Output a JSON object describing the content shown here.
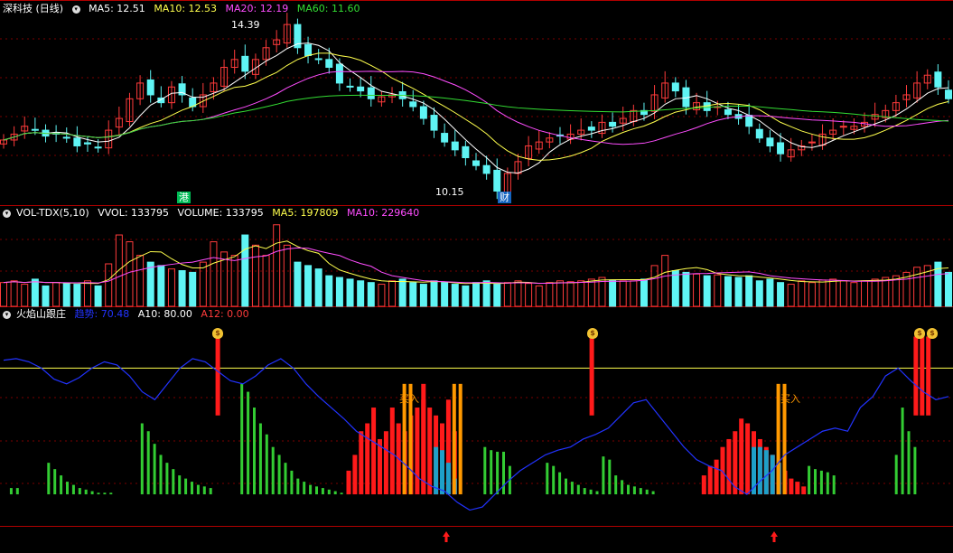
{
  "colors": {
    "up": "#ff3b3b",
    "down": "#5ff4f4",
    "ma5": "#ffffff",
    "ma10": "#ffff4d",
    "ma20": "#ff4dff",
    "ma60": "#33dd33",
    "axis": "#b00000",
    "grid": "#7a0000",
    "trend": "#2233ff",
    "ref": "#ffff4d",
    "green": "#33cc33",
    "red": "#ff1a1a",
    "orange": "#ff9900",
    "teal": "#1ea0c8"
  },
  "price_panel": {
    "title": "深科技 (日线)",
    "icon": "chevron-down-icon",
    "indicators": [
      {
        "label": "MA5: 12.51",
        "color": "#ffffff"
      },
      {
        "label": "MA10: 12.53",
        "color": "#ffff4d"
      },
      {
        "label": "MA20: 12.19",
        "color": "#ff4dff"
      },
      {
        "label": "MA60: 11.60",
        "color": "#33dd33"
      }
    ],
    "high_label": "14.39",
    "low_label": "10.15",
    "badge1": "港",
    "badge2": "财"
  },
  "volume_panel": {
    "title": "VOL-TDX(5,10)",
    "indicators": [
      {
        "label": "VVOL: 133795",
        "color": "#ffffff"
      },
      {
        "label": "VOLUME: 133795",
        "color": "#ffffff"
      },
      {
        "label": "MA5: 197809",
        "color": "#ffff4d"
      },
      {
        "label": "MA10: 229640",
        "color": "#ff4dff"
      }
    ]
  },
  "flame_panel": {
    "title": "火焰山跟庄",
    "indicators": [
      {
        "label": "趋势: 70.48",
        "color": "#2233ff"
      },
      {
        "label": "A10: 80.00",
        "color": "#ffffff"
      },
      {
        "label": "A12: 0.00",
        "color": "#ff3b3b"
      }
    ],
    "buy_label": "买入",
    "bag_glyph": "$"
  },
  "chart_data": [
    {
      "type": "candlestick",
      "title": "深科技 (日线)",
      "y_range_approx": [
        10.0,
        14.6
      ],
      "annotated_high": 14.39,
      "annotated_low": 10.15,
      "moving_averages": {
        "MA5": 12.51,
        "MA10": 12.53,
        "MA20": 12.19,
        "MA60": 11.6
      },
      "close_series": [
        11.45,
        11.6,
        11.8,
        11.7,
        11.55,
        11.6,
        11.5,
        11.3,
        11.35,
        11.25,
        11.7,
        12.0,
        12.5,
        12.9,
        12.6,
        12.4,
        12.8,
        12.6,
        12.3,
        12.6,
        12.9,
        13.3,
        13.5,
        13.2,
        13.5,
        13.8,
        14.0,
        14.39,
        13.8,
        13.6,
        13.5,
        13.3,
        12.9,
        12.8,
        12.7,
        12.5,
        12.55,
        12.6,
        12.5,
        12.3,
        12.0,
        11.7,
        11.4,
        11.2,
        11.0,
        10.8,
        10.6,
        10.15,
        10.6,
        10.9,
        11.3,
        11.4,
        11.5,
        11.55,
        11.6,
        11.7,
        11.7,
        11.9,
        11.8,
        12.0,
        12.2,
        12.1,
        12.6,
        12.9,
        12.7,
        12.3,
        12.4,
        12.2,
        12.3,
        12.1,
        12.0,
        11.8,
        11.5,
        11.3,
        11.1,
        11.2,
        11.3,
        11.4,
        11.6,
        11.7,
        11.8,
        11.8,
        11.9,
        12.1,
        12.2,
        12.4,
        12.6,
        12.9,
        13.1,
        12.8,
        12.5
      ]
    },
    {
      "type": "bar",
      "title": "VOL-TDX(5,10)",
      "latest": {
        "VOLUME": 133795,
        "MA5": 197809,
        "MA10": 229640
      },
      "volume_series": [
        140,
        150,
        130,
        160,
        120,
        140,
        135,
        130,
        150,
        120,
        250,
        420,
        380,
        300,
        260,
        240,
        220,
        210,
        200,
        260,
        380,
        320,
        300,
        420,
        360,
        300,
        480,
        360,
        260,
        240,
        220,
        180,
        170,
        160,
        150,
        140,
        130,
        150,
        160,
        140,
        130,
        150,
        140,
        130,
        120,
        140,
        150,
        130,
        140,
        150,
        135,
        120,
        140,
        150,
        145,
        150,
        160,
        170,
        155,
        150,
        150,
        160,
        240,
        300,
        210,
        200,
        190,
        180,
        185,
        175,
        170,
        180,
        150,
        160,
        140,
        130,
        150,
        140,
        155,
        160,
        150,
        140,
        150,
        160,
        170,
        180,
        200,
        230,
        240,
        260,
        200
      ]
    },
    {
      "type": "bar",
      "title": "火焰山跟庄",
      "latest": {
        "趋势": 70.48,
        "A10": 80.0,
        "A12": 0.0
      },
      "reference_line": 80.0,
      "trend_series": [
        85,
        86,
        84,
        80,
        73,
        70,
        74,
        80,
        84,
        82,
        75,
        65,
        60,
        70,
        80,
        86,
        84,
        78,
        72,
        70,
        75,
        82,
        86,
        80,
        70,
        62,
        55,
        48,
        40,
        35,
        30,
        25,
        18,
        10,
        5,
        2,
        -5,
        -10,
        -8,
        0,
        8,
        15,
        20,
        25,
        28,
        30,
        35,
        38,
        42,
        50,
        58,
        60,
        50,
        40,
        30,
        22,
        18,
        15,
        5,
        0,
        8,
        15,
        25,
        30,
        35,
        40,
        42,
        40,
        55,
        62,
        75,
        80,
        72,
        65,
        60,
        62
      ]
    }
  ]
}
